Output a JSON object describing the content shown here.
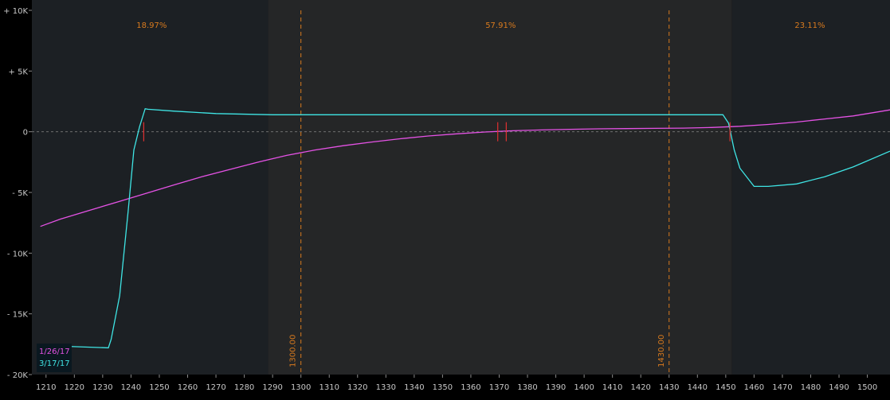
{
  "chart_data": {
    "type": "line",
    "xlim": [
      1205,
      1508
    ],
    "ylim": [
      -20000,
      10000
    ],
    "x_ticks": [
      1210,
      1220,
      1230,
      1240,
      1250,
      1260,
      1270,
      1280,
      1290,
      1300,
      1310,
      1320,
      1330,
      1340,
      1350,
      1360,
      1370,
      1380,
      1390,
      1400,
      1410,
      1420,
      1430,
      1440,
      1450,
      1460,
      1470,
      1480,
      1490,
      1500
    ],
    "y_ticks": [
      {
        "value": 10000,
        "label": "+ 10K"
      },
      {
        "value": 5000,
        "label": "+ 5K"
      },
      {
        "value": 0,
        "label": "0"
      },
      {
        "value": -5000,
        "label": "- 5K"
      },
      {
        "value": -10000,
        "label": "- 10K"
      },
      {
        "value": -15000,
        "label": "- 15K"
      },
      {
        "value": -20000,
        "label": "- 20K"
      }
    ],
    "zones": [
      {
        "from": 1205,
        "to": 1288.4,
        "label": "18.97%",
        "label_x": 1247.3,
        "color": "#1c2024"
      },
      {
        "from": 1288.4,
        "to": 1452.2,
        "label": "57.91%",
        "label_x": 1370.5,
        "color": "#252627"
      },
      {
        "from": 1452.2,
        "to": 1508,
        "label": "23.11%",
        "label_x": 1479.7,
        "color": "#1c2024"
      }
    ],
    "vlines": [
      {
        "x": 1300,
        "label": "1300.00"
      },
      {
        "x": 1430,
        "label": "1430.00"
      }
    ],
    "series": [
      {
        "name": "1/26/17",
        "color": "#e552e5",
        "x": [
          1208,
          1215,
          1225,
          1235,
          1245,
          1255,
          1265,
          1275,
          1285,
          1295,
          1305,
          1315,
          1325,
          1335,
          1345,
          1355,
          1365,
          1375,
          1385,
          1395,
          1405,
          1415,
          1425,
          1435,
          1445,
          1455,
          1465,
          1475,
          1485,
          1495,
          1508
        ],
        "values": [
          -7800,
          -7200,
          -6500,
          -5800,
          -5100,
          -4400,
          -3700,
          -3100,
          -2500,
          -1950,
          -1500,
          -1150,
          -850,
          -580,
          -350,
          -170,
          -20,
          80,
          150,
          200,
          240,
          260,
          280,
          300,
          350,
          450,
          600,
          800,
          1050,
          1300,
          1800
        ]
      },
      {
        "name": "3/17/17",
        "color": "#3fe5e5",
        "x": [
          1208,
          1232,
          1233,
          1236,
          1239,
          1241,
          1243,
          1245,
          1246,
          1255,
          1270,
          1290,
          1350,
          1449,
          1451,
          1453,
          1455,
          1460,
          1465,
          1475,
          1485,
          1495,
          1508
        ],
        "values": [
          -17600,
          -17800,
          -17100,
          -13500,
          -6500,
          -1500,
          400,
          1900,
          1850,
          1700,
          1500,
          1400,
          1400,
          1400,
          700,
          -1500,
          -3000,
          -4500,
          -4500,
          -4300,
          -3700,
          -2900,
          -1600
        ]
      }
    ],
    "breakevens": [
      1244.5,
      1369.5,
      1372.5,
      1451.5
    ]
  }
}
